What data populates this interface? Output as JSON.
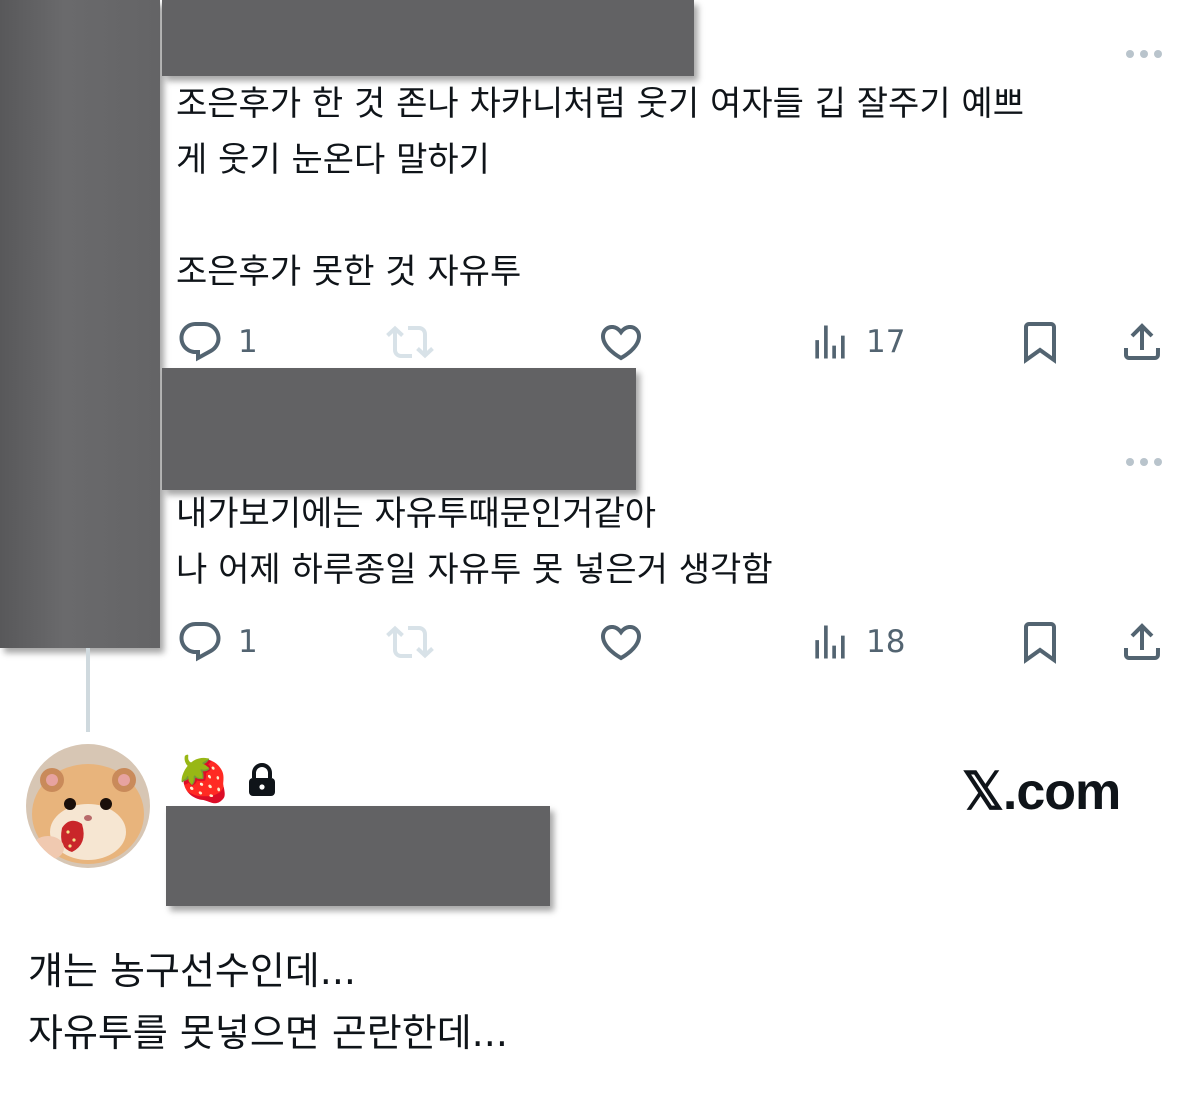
{
  "tweet1": {
    "text": "조은후가 한 것 존나 차카니처럼 웃기 여자들 깁 잘주기 예쁘\n게 웃기 눈온다 말하기\n\n조은후가 못한 것 자유투",
    "replies": "1",
    "views": "17"
  },
  "tweet2": {
    "text": "내가보기에는 자유투때문인거같아\n나 어제 하루종일 자유투 못 넣은거 생각함",
    "replies": "1",
    "views": "18"
  },
  "quoted_user": {
    "badge_emoji": "🍓",
    "lock_icon": "lock-icon"
  },
  "watermark": "𝕏.com",
  "reply": {
    "text": "걔는 농구선수인데...\n자유투를 못넣으면 곤란한데..."
  },
  "colors": {
    "text": "#0f1419",
    "icon": "#536471",
    "redaction": "#626264"
  }
}
